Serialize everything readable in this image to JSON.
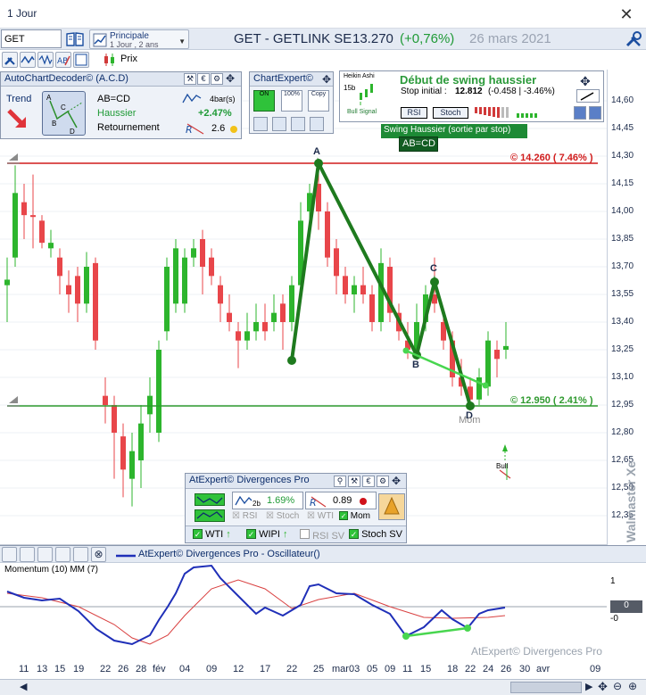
{
  "window": {
    "title": "1 Jour",
    "close_glyph": "✕"
  },
  "toolbar": {
    "symbol_value": "GET",
    "period_title": "Principale",
    "period_sub": "1 Jour , 2 ans",
    "instrument": "GET - GETLINK SE",
    "last_price": "13.270",
    "change": "(+0,76%)",
    "date": "26 mars 2021",
    "prix_label": "Prix"
  },
  "colors": {
    "bull": "#2db52d",
    "bear": "#e8464a",
    "pattern": "#1e7a1e",
    "resistance": "#d11c1c",
    "support": "#2f9a2f",
    "momentum": "#1f2fb8",
    "signal": "#d94040"
  },
  "acd_panel": {
    "title": "AutoChartDecoder© (A.C.D)",
    "trend_label": "Trend",
    "pattern_letters": [
      "A",
      "C",
      "B",
      "D"
    ],
    "pattern_name": "AB=CD",
    "direction": "Haussier",
    "status": "Retournement",
    "bars": "4bar(s)",
    "gain": "+2.47%",
    "rr_value": "2.6"
  },
  "chartexpert": {
    "title": "ChartExpert©",
    "on_label": "ON",
    "pct_label": "100%",
    "copy_label": "Copy"
  },
  "swing_panel": {
    "heikin_title": "Heikin Ashi",
    "period": "15b",
    "bull_signal": "Bull Signal",
    "heading": "Début de swing haussier",
    "stop_label": "Stop initial :",
    "stop_value": "12.812",
    "stop_detail": "(-0.458 | -3.46%)",
    "rsi_btn": "RSI",
    "stoch_btn": "Stoch"
  },
  "chart_labels": {
    "swing": "Swing Haussier (sortie par stop)",
    "abcd": "AB=CD",
    "resistance": "© 14.260 ( 7.46% )",
    "support": "© 12.950 ( 2.41% )",
    "point_a": "A",
    "point_b": "B",
    "point_c": "C",
    "point_d": "D",
    "mom_tag": "Mom",
    "bull_tag": "Bull"
  },
  "y_axis": [
    "14,60",
    "14,45",
    "14,30",
    "14,15",
    "14,00",
    "13,85",
    "13,70",
    "13,55",
    "13,40",
    "13,25",
    "13,10",
    "12,95",
    "12,80",
    "12,65",
    "12,50",
    "12,35"
  ],
  "x_axis": [
    "11",
    "13",
    "15",
    "19",
    "22",
    "26",
    "28",
    "fév",
    "04",
    "09",
    "12",
    "17",
    "22",
    "25",
    "mar",
    "03",
    "05",
    "09",
    "11",
    "15",
    "18",
    "22",
    "24",
    "26",
    "30",
    "avr",
    "09"
  ],
  "divergence_panel": {
    "title": "AtExpert© Divergences Pro",
    "period": "2b",
    "pct": "1.69%",
    "rr": "0.89",
    "opt_rsi": "RSI",
    "opt_stoch": "Stoch",
    "opt_wti": "WTI",
    "opt_mom": "Mom",
    "chk_wti": "WTI",
    "chk_wipi": "WIPI",
    "chk_rsi_sv": "RSI SV",
    "chk_stoch_sv": "Stoch SV"
  },
  "oscillator": {
    "bar_title": "AtExpert© Divergences Pro - Oscillateur()",
    "name": "Momentum (10) MM (7)",
    "scale_top": "1",
    "scale_zero": "0",
    "scale_neg": "-0",
    "watermark": "AtExpert© Divergences Pro"
  },
  "brand": {
    "watermark": "Walmaster Xe"
  }
}
